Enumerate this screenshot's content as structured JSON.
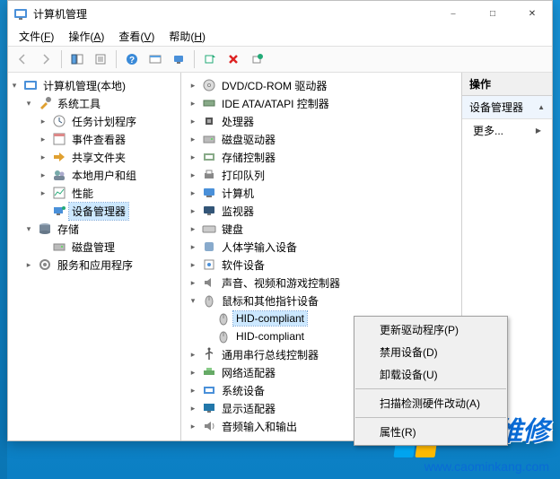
{
  "window": {
    "title": "计算机管理"
  },
  "menubar": [
    {
      "label": "文件",
      "hotkey": "F"
    },
    {
      "label": "操作",
      "hotkey": "A"
    },
    {
      "label": "查看",
      "hotkey": "V"
    },
    {
      "label": "帮助",
      "hotkey": "H"
    }
  ],
  "left_tree": {
    "root": {
      "label": "计算机管理(本地)",
      "icon": "mgmt",
      "expanded": true
    },
    "system_tools": {
      "label": "系统工具",
      "icon": "tools",
      "expanded": true,
      "children": [
        {
          "label": "任务计划程序",
          "icon": "task",
          "expandable": true
        },
        {
          "label": "事件查看器",
          "icon": "event",
          "expandable": true
        },
        {
          "label": "共享文件夹",
          "icon": "share",
          "expandable": true
        },
        {
          "label": "本地用户和组",
          "icon": "users",
          "expandable": true
        },
        {
          "label": "性能",
          "icon": "perf",
          "expandable": true
        },
        {
          "label": "设备管理器",
          "icon": "device",
          "selected": true
        }
      ]
    },
    "storage": {
      "label": "存储",
      "icon": "storage",
      "expanded": true,
      "children": [
        {
          "label": "磁盘管理",
          "icon": "disk"
        }
      ]
    },
    "services": {
      "label": "服务和应用程序",
      "icon": "services",
      "expandable": true
    }
  },
  "device_tree": [
    {
      "label": "DVD/CD-ROM 驱动器",
      "icon": "dvd"
    },
    {
      "label": "IDE ATA/ATAPI 控制器",
      "icon": "ide"
    },
    {
      "label": "处理器",
      "icon": "cpu"
    },
    {
      "label": "磁盘驱动器",
      "icon": "disk"
    },
    {
      "label": "存储控制器",
      "icon": "storage-ctrl"
    },
    {
      "label": "打印队列",
      "icon": "printer"
    },
    {
      "label": "计算机",
      "icon": "computer"
    },
    {
      "label": "监视器",
      "icon": "monitor"
    },
    {
      "label": "键盘",
      "icon": "keyboard"
    },
    {
      "label": "人体学输入设备",
      "icon": "hid"
    },
    {
      "label": "软件设备",
      "icon": "software"
    },
    {
      "label": "声音、视频和游戏控制器",
      "icon": "sound"
    },
    {
      "label": "鼠标和其他指针设备",
      "icon": "mouse",
      "expanded": true,
      "children": [
        {
          "label": "HID-compliant",
          "icon": "mouse",
          "selected": true
        },
        {
          "label": "HID-compliant",
          "icon": "mouse"
        }
      ]
    },
    {
      "label": "通用串行总线控制器",
      "icon": "usb"
    },
    {
      "label": "网络适配器",
      "icon": "network"
    },
    {
      "label": "系统设备",
      "icon": "system"
    },
    {
      "label": "显示适配器",
      "icon": "display"
    },
    {
      "label": "音频输入和输出",
      "icon": "audio"
    }
  ],
  "right_pane": {
    "header": "操作",
    "subheader": "设备管理器",
    "more": "更多..."
  },
  "context_menu": [
    {
      "label": "更新驱动程序(P)"
    },
    {
      "label": "禁用设备(D)"
    },
    {
      "label": "卸载设备(U)"
    },
    {
      "sep": true
    },
    {
      "label": "扫描检测硬件改动(A)"
    },
    {
      "sep": true
    },
    {
      "label": "属性(R)"
    }
  ],
  "watermark": {
    "text": "电脑维修",
    "url": "www.caominkang.com"
  }
}
